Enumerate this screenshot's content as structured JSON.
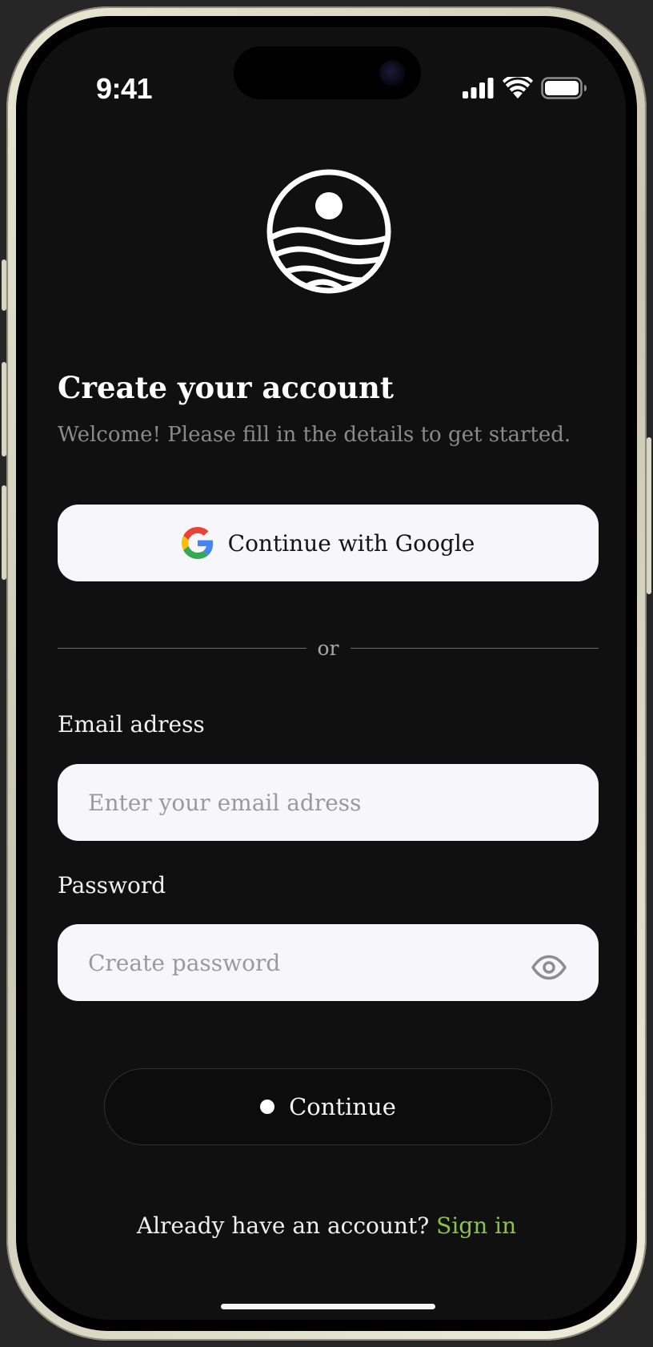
{
  "status_bar": {
    "time": "9:41",
    "icons": [
      "signal-icon",
      "wifi-icon",
      "battery-icon"
    ]
  },
  "logo": {
    "icon": "sun-over-waves-logo"
  },
  "header": {
    "title": "Create your account",
    "subtitle": "Welcome! Please fill in the details to get started."
  },
  "google_button": {
    "label": "Continue with Google",
    "icon": "google-icon"
  },
  "divider": {
    "text": "or"
  },
  "email": {
    "label": "Email adress",
    "value": "",
    "placeholder": "Enter your email adress"
  },
  "password": {
    "label": "Password",
    "value": "",
    "placeholder": "Create password",
    "toggle_icon": "eye-icon"
  },
  "continue_button": {
    "label": "Continue"
  },
  "footer": {
    "prompt": "Already have an account?",
    "link": "Sign in"
  },
  "colors": {
    "background": "#101010",
    "surface": "#f7f7fb",
    "link": "#8bc34a",
    "muted_text": "#8a8a8a"
  }
}
